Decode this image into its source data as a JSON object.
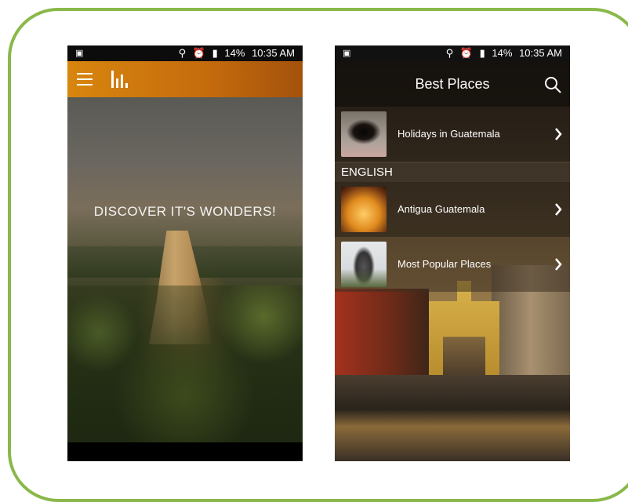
{
  "left_phone": {
    "status": {
      "time": "10:35 AM",
      "battery": "14%"
    },
    "hero_title": "DISCOVER IT'S WONDERS!"
  },
  "right_phone": {
    "status": {
      "time": "10:35 AM",
      "battery": "14%"
    },
    "title": "Best Places",
    "items": [
      {
        "label": "Holidays in Guatemala"
      },
      {
        "label": "Antigua Guatemala"
      },
      {
        "label": "Most Popular Places"
      }
    ],
    "section_header": "ENGLISH"
  },
  "colors": {
    "frame_border": "#8ab84a",
    "appbar_orange": "#d8860f"
  },
  "icons": {
    "menu": "hamburger-icon",
    "stats": "bar-chart-icon",
    "search": "search-icon",
    "chevron": "chevron-right-icon"
  }
}
